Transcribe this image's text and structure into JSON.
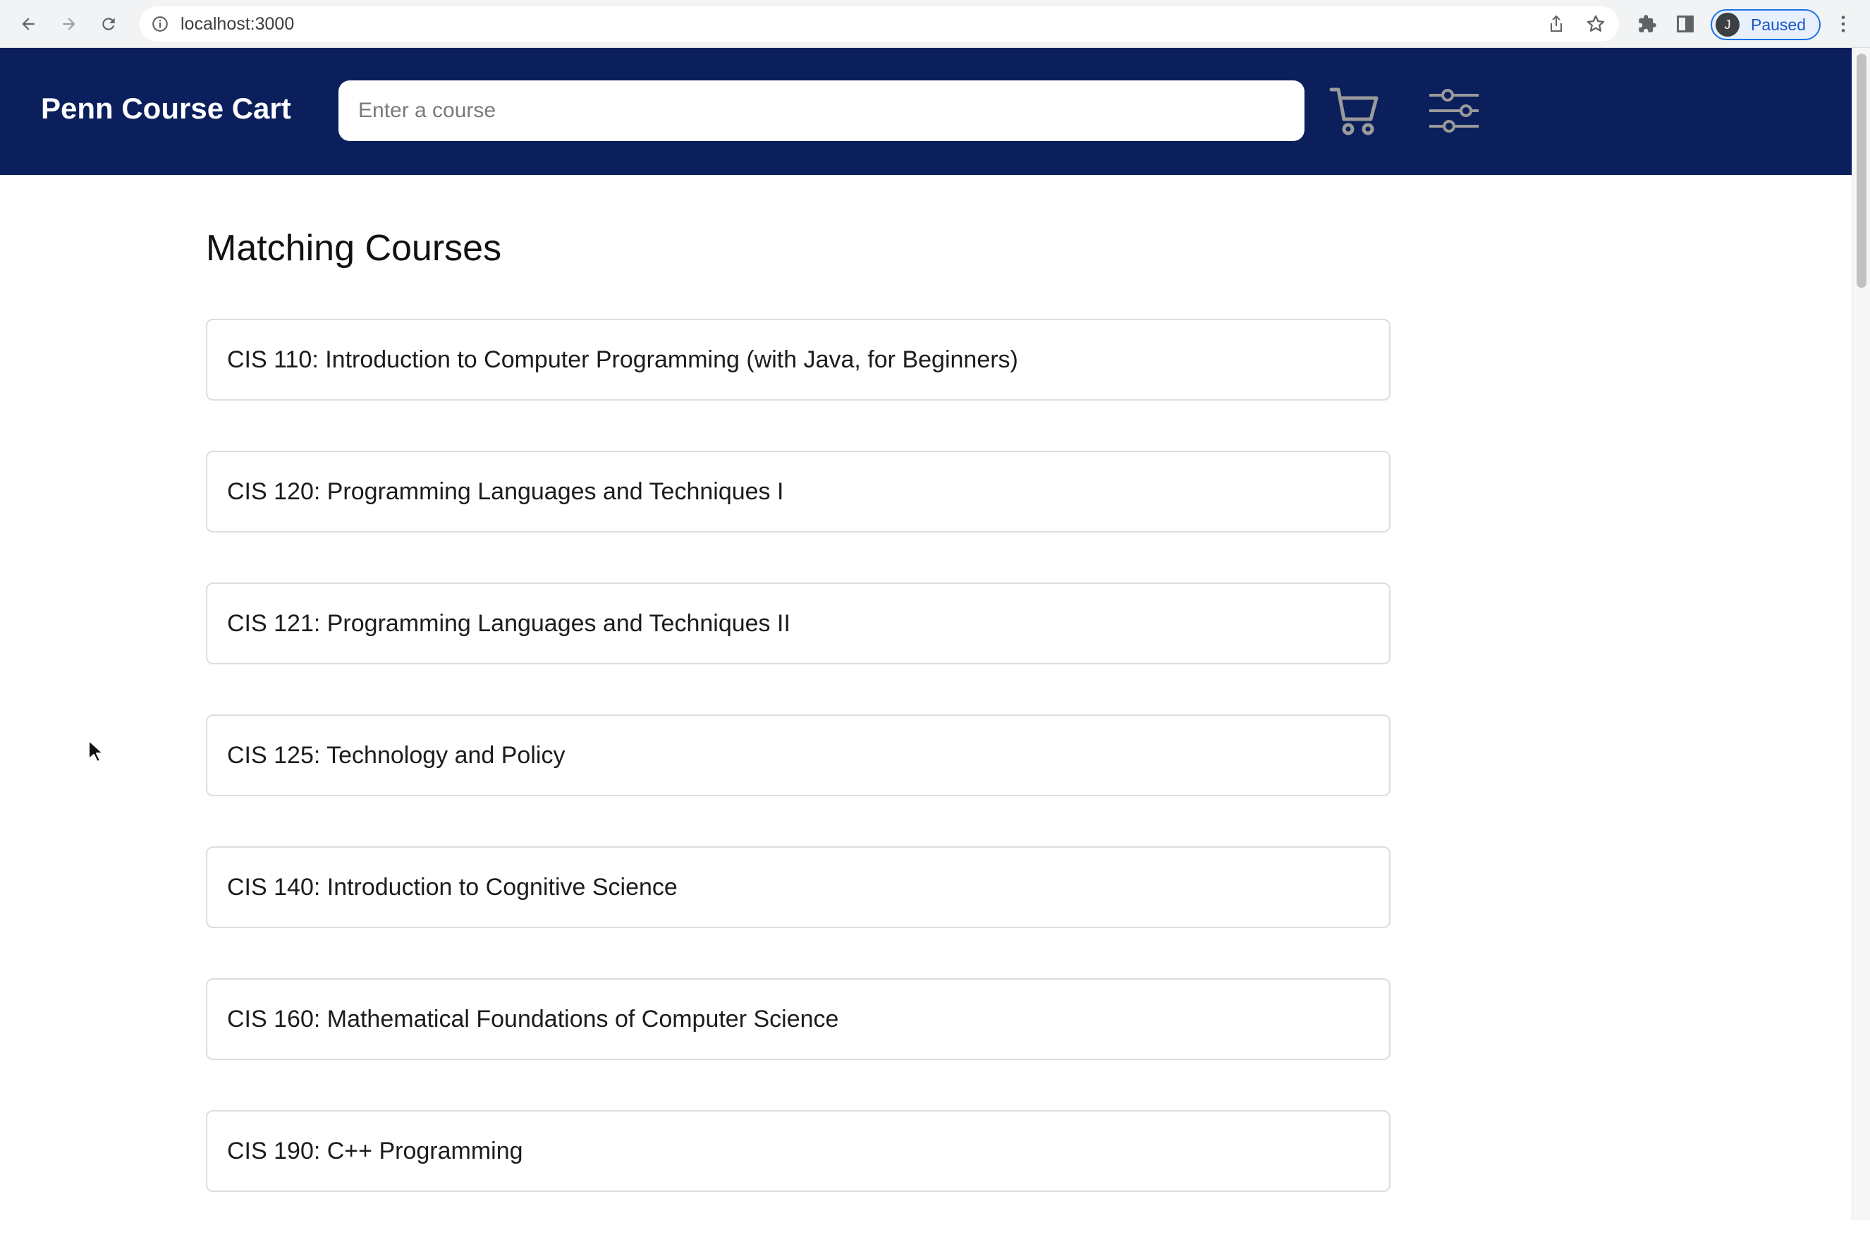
{
  "browser": {
    "url": "localhost:3000",
    "profile_initial": "J",
    "profile_status": "Paused",
    "accent_color": "#1a73e8"
  },
  "header": {
    "brand": "Penn Course Cart",
    "search_placeholder": "Enter a course",
    "search_value": "",
    "cart_icon": "cart-icon",
    "filter_icon": "sliders-icon",
    "background_color": "#0a1f5c"
  },
  "main": {
    "title": "Matching Courses",
    "courses": [
      "CIS 110: Introduction to Computer Programming (with Java, for Beginners)",
      "CIS 120: Programming Languages and Techniques I",
      "CIS 121: Programming Languages and Techniques II",
      "CIS 125: Technology and Policy",
      "CIS 140: Introduction to Cognitive Science",
      "CIS 160: Mathematical Foundations of Computer Science",
      "CIS 190: C++ Programming"
    ]
  }
}
